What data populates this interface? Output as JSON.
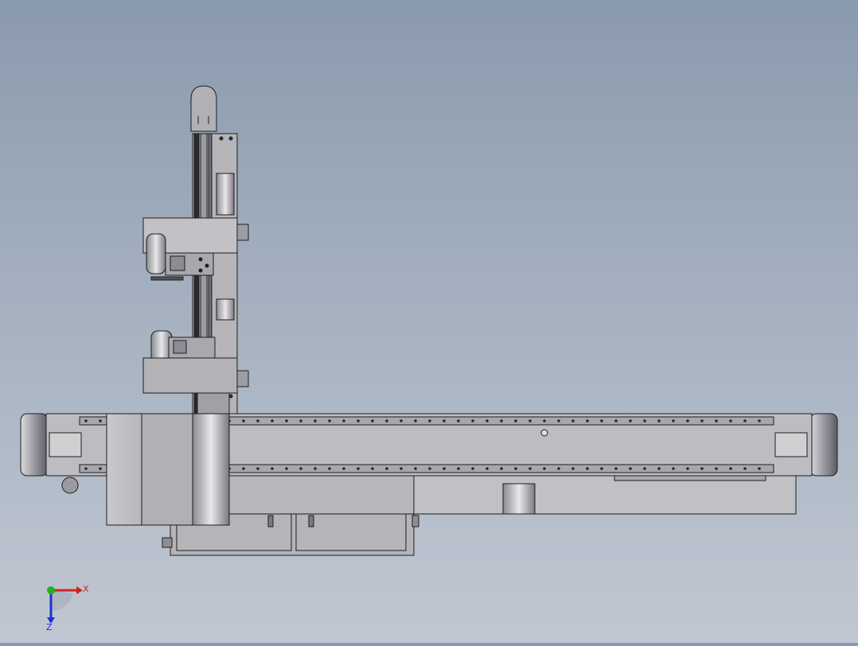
{
  "viewport": {
    "background_top": "#8a9aad",
    "background_bottom": "#c0c7d2",
    "part_fill": "#b9b9bd",
    "part_dark": "#8f8f96",
    "edge_color": "#1e1e1e"
  },
  "triad": {
    "x_label": "X",
    "z_label": "Z",
    "x_color": "#d42020",
    "y_color": "#20b020",
    "z_color": "#2030d0"
  }
}
